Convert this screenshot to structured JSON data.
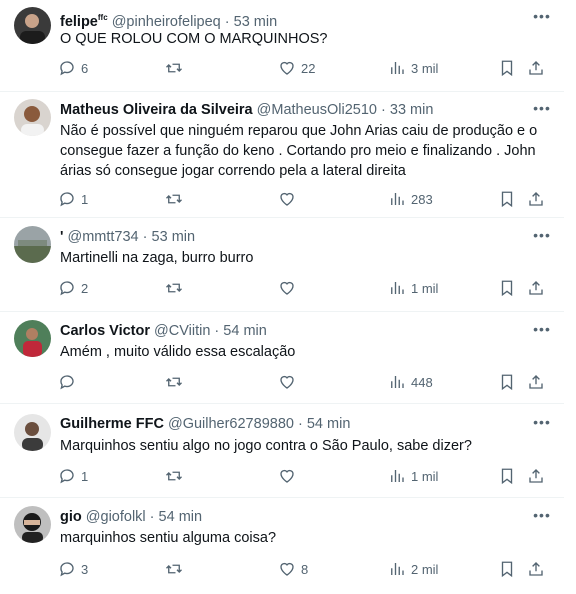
{
  "tweets": [
    {
      "name": "felipe",
      "badge": "ffc",
      "handle": "@pinheirofelipeq",
      "time": "53 min",
      "text": "O QUE ROLOU COM O MARQUINHOS?",
      "replies": "6",
      "retweets": "",
      "likes": "22",
      "views": "3 mil"
    },
    {
      "name": "Matheus Oliveira da Silveira",
      "badge": "",
      "handle": "@MatheusOli2510",
      "time": "33 min",
      "text": "Não é possível que ninguém reparou que John Arias caiu de produção e o consegue fazer a função do keno . Cortando pro meio e finalizando . John árias só consegue jogar correndo pela a lateral direita",
      "replies": "1",
      "retweets": "",
      "likes": "",
      "views": "283"
    },
    {
      "name": "'",
      "badge": "",
      "handle": "@mmtt734",
      "time": "53 min",
      "text": "Martinelli na zaga, burro burro",
      "replies": "2",
      "retweets": "",
      "likes": "",
      "views": "1 mil"
    },
    {
      "name": "Carlos Victor",
      "badge": "",
      "handle": "@CViitin",
      "time": "54 min",
      "text": "Amém , muito válido essa escalação",
      "replies": "",
      "retweets": "",
      "likes": "",
      "views": "448"
    },
    {
      "name": "Guilherme FFC",
      "badge": "",
      "handle": "@Guilher62789880",
      "time": "54 min",
      "text": "Marquinhos sentiu algo no jogo contra o São Paulo, sabe dizer?",
      "replies": "1",
      "retweets": "",
      "likes": "",
      "views": "1 mil"
    },
    {
      "name": "gio",
      "badge": "",
      "handle": "@giofolkl",
      "time": "54 min",
      "text": "marquinhos sentiu alguma coisa?",
      "replies": "3",
      "retweets": "",
      "likes": "8",
      "views": "2 mil"
    }
  ],
  "separator": "·",
  "icons": {
    "reply": "reply-icon",
    "retweet": "retweet-icon",
    "like": "heart-icon",
    "views": "views-icon",
    "bookmark": "bookmark-icon",
    "share": "share-icon",
    "more": "more-icon"
  },
  "colors": {
    "text": "#0f1419",
    "muted": "#536471",
    "divider": "#eff3f4"
  }
}
